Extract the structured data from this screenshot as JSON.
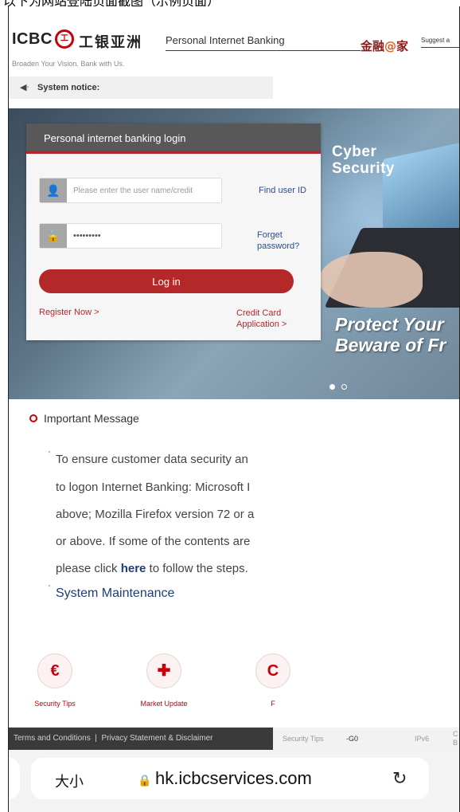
{
  "caption": "以下为网站登陆页面截图（示例页面）",
  "header": {
    "logo_en": "ICBC",
    "logo_mark": "工",
    "logo_cn": "工银亚洲",
    "product": "Personal Internet Banking",
    "jr_1": "金融",
    "jr_at": "@",
    "jr_2": "家",
    "suggest": "Suggest a",
    "slogan": "Broaden Your Vision. Bank with Us."
  },
  "notice": {
    "icon": "speaker-icon",
    "label": "System notice:"
  },
  "banner": {
    "cyber_line1": "Cyber",
    "cyber_line2": "Security",
    "protect_line1": "Protect Your",
    "protect_line2": "Beware of Fr",
    "slides": 2,
    "active_slide": 1
  },
  "login": {
    "title": "Personal internet banking login",
    "username_placeholder": "Please enter the user name/credit",
    "password_value": "•••••••••",
    "find_user_id": "Find user ID",
    "forget_line1": "Forget",
    "forget_line2": "password?",
    "login_button": "Log in",
    "register": "Register Now >",
    "credit_line1": "Credit Card",
    "credit_line2": "Application >"
  },
  "message": {
    "title": "Important Message",
    "line1": "To ensure customer data security an",
    "line2": "to logon Internet Banking: Microsoft I",
    "line3": "above; Mozilla Firefox version 72 or a",
    "line4": "or above. If some of the contents are",
    "line5_pre": "please click ",
    "line5_link": "here",
    "line5_post": " to follow the steps.",
    "maintenance": "System Maintenance"
  },
  "shortcuts": [
    {
      "label": "Security Tips",
      "glyph": "€",
      "icon": "security-tips-icon"
    },
    {
      "label": "Market Update",
      "glyph": "✚",
      "icon": "market-update-icon"
    },
    {
      "label": "F",
      "glyph": "C",
      "icon": "shortcut-icon"
    }
  ],
  "footer": {
    "terms": "Terms and Conditions",
    "sep": "|",
    "privacy": "Privacy Statement & Disclaimer",
    "security_tips": "Security Tips",
    "g0": "-G0",
    "ipv6": "IPv6",
    "c": "C",
    "b": "B"
  },
  "browser": {
    "text_size": "大小",
    "lock_icon": "lock-icon",
    "url": "hk.icbcservices.com",
    "reload_icon": "reload-icon"
  },
  "colors": {
    "brand_red": "#c7000b",
    "button_red": "#b5282a",
    "link_blue": "#2b4f8c"
  }
}
